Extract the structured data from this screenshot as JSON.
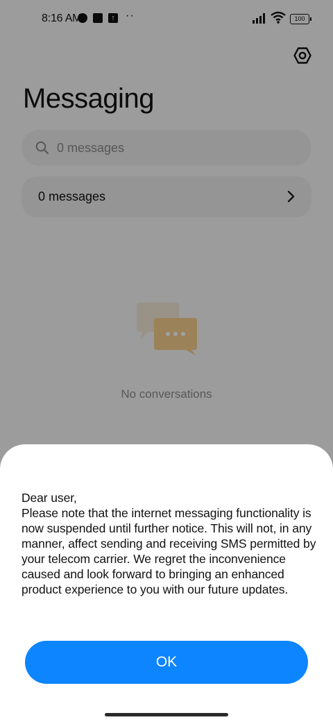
{
  "status_bar": {
    "time": "8:16 AM",
    "battery": "100",
    "icons": [
      "alarm-icon",
      "square-notification-icon",
      "upload-icon",
      "more-dots-icon",
      "signal-icon",
      "wifi-icon",
      "battery-icon"
    ]
  },
  "header": {
    "title": "Messaging",
    "settings_icon": "settings-icon"
  },
  "search": {
    "placeholder": "0 messages"
  },
  "summary": {
    "label": "0 messages"
  },
  "empty_state": {
    "text": "No conversations"
  },
  "dialog": {
    "greeting": "Dear user,",
    "message": "Please note that the internet messaging functionality is now suspended until further notice. This will not, in any manner, affect sending and receiving SMS permitted by your telecom carrier. We regret the inconvenience caused and look forward to bringing an enhanced product experience to you with our future updates.",
    "ok_label": "OK"
  },
  "colors": {
    "accent": "#0c85ff",
    "background": "#f7f7f7",
    "illustration_back": "#f3e8d6",
    "illustration_front": "#f5ce8c"
  }
}
